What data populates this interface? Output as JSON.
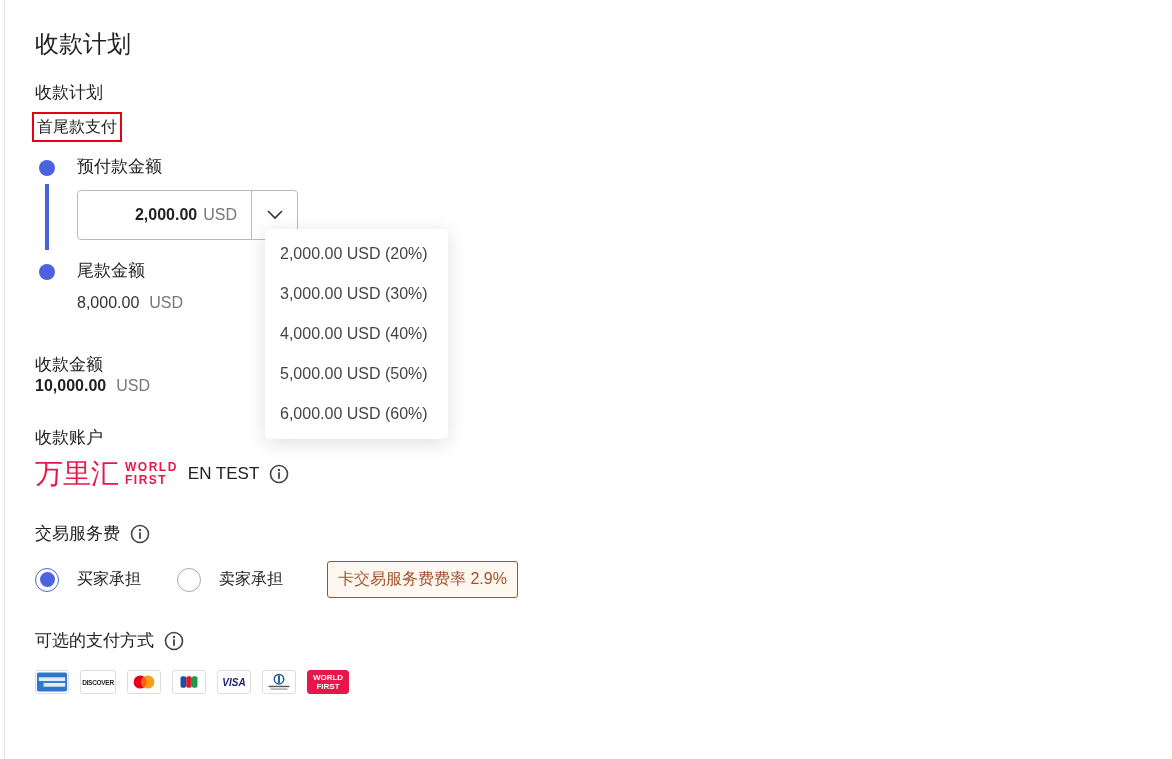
{
  "title": "收款计划",
  "plan": {
    "label": "收款计划",
    "value": "首尾款支付",
    "highlighted": true
  },
  "steps": [
    {
      "kind": "input",
      "label": "预付款金额",
      "amount": "2,000.00",
      "currency": "USD",
      "expanded": true
    },
    {
      "kind": "text",
      "label": "尾款金额",
      "amount": "8,000.00",
      "currency": "USD"
    }
  ],
  "dropdown_options": [
    "2,000.00 USD (20%)",
    "3,000.00 USD (30%)",
    "4,000.00 USD (40%)",
    "5,000.00 USD (50%)",
    "6,000.00 USD (60%)"
  ],
  "total": {
    "label": "收款金额",
    "amount": "10,000.00",
    "currency": "USD"
  },
  "account": {
    "label": "收款账户",
    "brand_cn": "万里汇",
    "brand_en_1": "WORLD",
    "brand_en_2": "FIRST",
    "name": "EN TEST"
  },
  "fee": {
    "label": "交易服务费",
    "options": [
      {
        "label": "买家承担",
        "selected": true
      },
      {
        "label": "卖家承担",
        "selected": false
      }
    ],
    "rate_tag": "卡交易服务费费率 2.9%"
  },
  "payment_methods": {
    "label": "可选的支付方式",
    "items": [
      {
        "kind": "amex"
      },
      {
        "kind": "discover",
        "text": "DISCOVER"
      },
      {
        "kind": "mastercard"
      },
      {
        "kind": "jcb"
      },
      {
        "kind": "visa",
        "text": "VISA"
      },
      {
        "kind": "diners"
      },
      {
        "kind": "worldfirst",
        "text": "WORLD FIRST"
      }
    ]
  }
}
